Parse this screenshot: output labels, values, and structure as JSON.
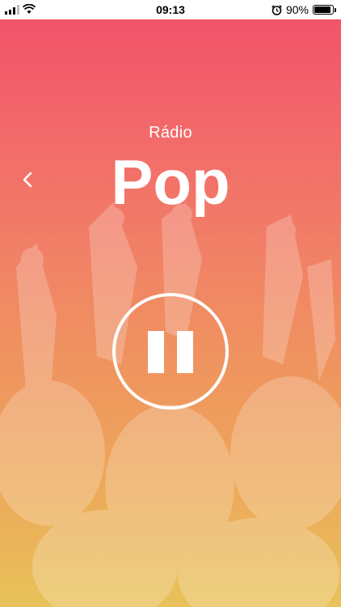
{
  "status_bar": {
    "time": "09:13",
    "battery_percent_label": "90%",
    "battery_level": 0.9
  },
  "header": {
    "subtitle": "Rádio",
    "title": "Pop"
  },
  "icons": {
    "back": "chevron-left-icon",
    "playback": "pause-icon"
  },
  "colors": {
    "gradient_top": "#f2506a",
    "gradient_bottom": "#e8c25a",
    "foreground": "#ffffff"
  }
}
